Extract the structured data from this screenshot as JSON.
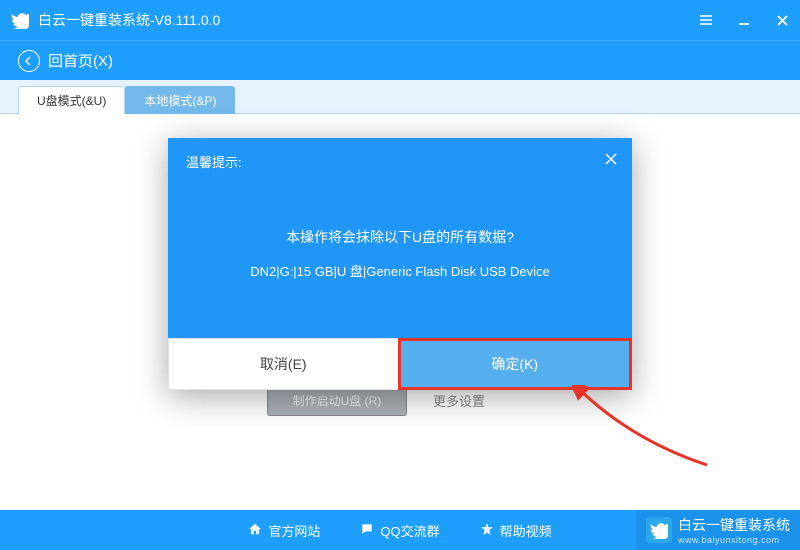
{
  "titlebar": {
    "title": "白云一键重装系统-V8.111.0.0"
  },
  "backbar": {
    "label": "回首页(X)"
  },
  "tabs": {
    "usb": "U盘模式(&U)",
    "local": "本地模式(&P)"
  },
  "bg_buttons": {
    "make": "制作启动U盘 (R)",
    "more": "更多设置"
  },
  "footer": {
    "site": "官方网站",
    "qq": "QQ交流群",
    "help": "帮助视频",
    "brand": "白云一键重装系统",
    "brand_sub": "www.baiyunxitong.com"
  },
  "modal": {
    "title": "温馨提示:",
    "line1": "本操作将会抹除以下U盘的所有数据?",
    "line2": "DN2|G:|15 GB|U 盘|Generic Flash Disk USB Device",
    "cancel": "取消(E)",
    "ok": "确定(K)"
  }
}
